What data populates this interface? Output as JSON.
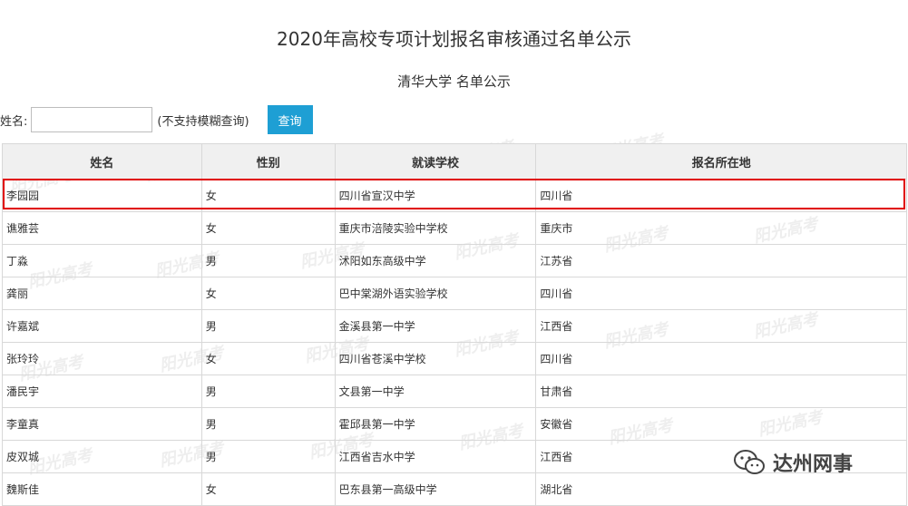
{
  "page_title": "2020年高校专项计划报名审核通过名单公示",
  "sub_title": "清华大学 名单公示",
  "search": {
    "label": "姓名:",
    "value": "",
    "placeholder": "",
    "hint": "(不支持模糊查询)",
    "button_label": "查询",
    "button_color": "#1e9fd4"
  },
  "table": {
    "headers": [
      "姓名",
      "性别",
      "就读学校",
      "报名所在地"
    ],
    "rows": [
      [
        "李园园",
        "女",
        "四川省宣汉中学",
        "四川省"
      ],
      [
        "谯雅芸",
        "女",
        "重庆市涪陵实验中学校",
        "重庆市"
      ],
      [
        "丁淼",
        "男",
        "沭阳如东高级中学",
        "江苏省"
      ],
      [
        "龚丽",
        "女",
        "巴中棠湖外语实验学校",
        "四川省"
      ],
      [
        "许嘉斌",
        "男",
        "金溪县第一中学",
        "江西省"
      ],
      [
        "张玲玲",
        "女",
        "四川省苍溪中学校",
        "四川省"
      ],
      [
        "潘民宇",
        "男",
        "文县第一中学",
        "甘肃省"
      ],
      [
        "李童真",
        "男",
        "霍邱县第一中学",
        "安徽省"
      ],
      [
        "皮双城",
        "男",
        "江西省吉水中学",
        "江西省"
      ],
      [
        "魏斯佳",
        "女",
        "巴东县第一高级中学",
        "湖北省"
      ]
    ],
    "highlight_color": "#e00000"
  },
  "watermark_text": "阳光高考",
  "logo": {
    "text": "达州网事",
    "icon": "wechat-icon"
  }
}
